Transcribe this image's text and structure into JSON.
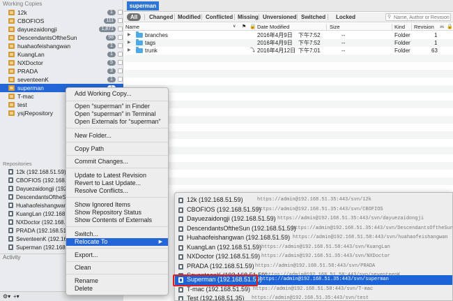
{
  "sidebar": {
    "working_copies_header": "Working Copies",
    "working_copies": [
      {
        "name": "12k",
        "badge": "1"
      },
      {
        "name": "CBOFIOS",
        "badge": "111"
      },
      {
        "name": "dayuezaidongji",
        "badge": "1,871"
      },
      {
        "name": "DescendantsOftheSun",
        "badge": "98"
      },
      {
        "name": "huahaofeishangwan",
        "badge": "1"
      },
      {
        "name": "KuangLan",
        "badge": "1"
      },
      {
        "name": "NXDoctor",
        "badge": "5"
      },
      {
        "name": "PRADA",
        "badge": "3"
      },
      {
        "name": "seventeenK",
        "badge": "1"
      },
      {
        "name": "superman",
        "badge": "1"
      },
      {
        "name": "T-mac",
        "badge": ""
      },
      {
        "name": "test",
        "badge": ""
      },
      {
        "name": "ysjRepository",
        "badge": ""
      }
    ],
    "repositories_header": "Repositories",
    "repositories": [
      "12k (192.168.51.59)",
      "CBOFIOS (192.168.51.59)",
      "Dayuezaidongji (192.168.51.59)",
      "DescendantsOftheSun (192.168.51.59)",
      "Huahaofeishangwan (192.168.51.59)",
      "KuangLan (192.168.51.59)",
      "NXDoctor (192.168.51.59)",
      "PRADA (192.168.51.59)",
      "SeventeenK (192.168.51.59)",
      "Superman (192.168.51.59)"
    ],
    "activity_header": "Activity",
    "footer": {
      "gear": "⚙▾",
      "add": "+▾"
    }
  },
  "toolbar": {
    "tab": "superman"
  },
  "filters": {
    "all": "All",
    "changed": "Changed",
    "modified": "Modified",
    "conflicted": "Conflicted",
    "missing": "Missing",
    "unversioned": "Unversioned",
    "switched": "Switched",
    "locked": "Locked",
    "search_placeholder": "Name, Author or Revision"
  },
  "columns": {
    "name": "Name",
    "date": "Date Modified",
    "size": "Size",
    "kind": "Kind",
    "revision": "Revision"
  },
  "files": [
    {
      "name": "branches",
      "date": "2016年4月9日",
      "time": "下午7:52",
      "size": "--",
      "kind": "Folder",
      "revision": "1",
      "updated": false
    },
    {
      "name": "tags",
      "date": "2016年4月9日",
      "time": "下午7:52",
      "size": "--",
      "kind": "Folder",
      "revision": "1",
      "updated": false
    },
    {
      "name": "trunk",
      "date": "2016年4月12日",
      "time": "下午7:01",
      "size": "--",
      "kind": "Folder",
      "revision": "63",
      "updated": true
    }
  ],
  "context_menu": {
    "add_wc": "Add Working Copy...",
    "open_finder": "Open “superman” in Finder",
    "open_terminal": "Open “superman” in Terminal",
    "open_externals": "Open Externals for “superman”",
    "new_folder": "New Folder...",
    "copy_path": "Copy Path",
    "commit": "Commit Changes...",
    "update": "Update to Latest Revision",
    "revert": "Revert to Last Update...",
    "resolve": "Resolve Conflicts...",
    "show_ignored": "Show Ignored Items",
    "show_status": "Show Repository Status",
    "show_externals": "Show Contents of Externals",
    "switch": "Switch...",
    "relocate": "Relocate To",
    "export": "Export...",
    "clean": "Clean",
    "rename": "Rename",
    "delete": "Delete"
  },
  "relocate_menu": [
    {
      "name": "12k (192.168.51.59)",
      "url": "https://admin@192.168.51.35:443/svn/12k"
    },
    {
      "name": "CBOFIOS (192.168.51.59)",
      "url": "https://admin@192.168.51.35:443/svn/CBOFIOS"
    },
    {
      "name": "Dayuezaidongji (192.168.51.59)",
      "url": "https://admin@192.168.51.35:443/svn/dayuezaidongji"
    },
    {
      "name": "DescendantsOftheSun (192.168.51.59)",
      "url": "https://admin@192.168.51.35:443/svn/DescendantsOftheSun"
    },
    {
      "name": "Huahaofeishangwan (192.168.51.59)",
      "url": "https://admin@192.168.51.58:443/svn/huahaofeishangwan"
    },
    {
      "name": "KuangLan (192.168.51.59)",
      "url": "https://admin@192.168.51.58:443/svn/KuangLan"
    },
    {
      "name": "NXDoctor (192.168.51.59)",
      "url": "https://admin@192.168.51.35:443/svn/NXDoctor"
    },
    {
      "name": "PRADA (192.168.51.59)",
      "url": "https://admin@192.168.51.58:443/svn/PRADA"
    },
    {
      "name": "SeventeenK (192.168.51.59)",
      "url": "https://admin@192.168.51.58:443/svn/seventeenK"
    },
    {
      "name": "Superman (192.168.51.59)",
      "url": "https://admin@192.168.51.35:443/svn/superman"
    },
    {
      "name": "T-mac (192.168.51.59)",
      "url": "https://admin@192.168.51.58:443/svn/T-mac"
    },
    {
      "name": "Test (192.168.51.35)",
      "url": "https://admin@192.168.51.35:443/svn/test"
    }
  ],
  "colors": {
    "selection": "#2466d7",
    "highlight_box": "#e02020",
    "folder": "#4fa9e6"
  }
}
